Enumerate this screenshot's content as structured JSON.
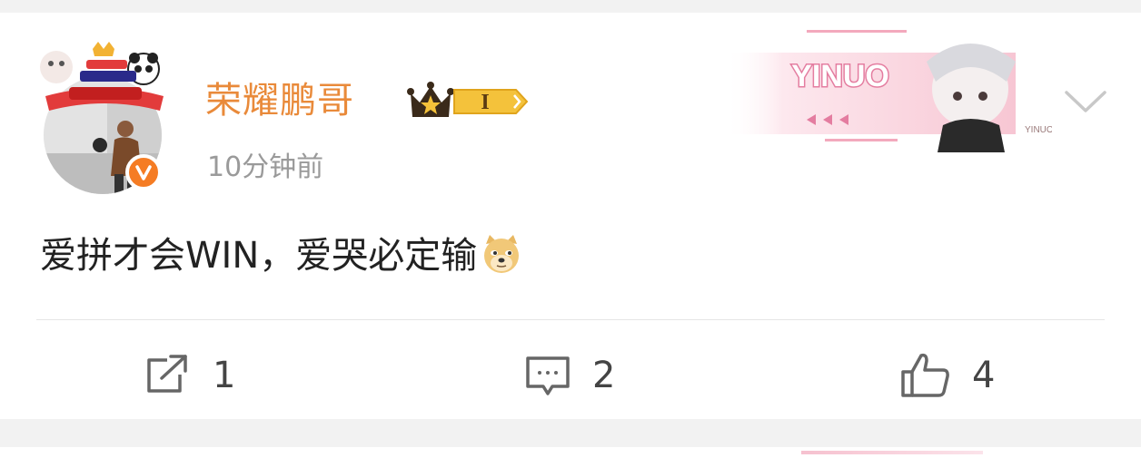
{
  "post": {
    "author": {
      "name": "荣耀鹏哥",
      "avatar_icon": "avatar-photo",
      "verified_icon": "verified-v-icon",
      "verified_color": "#f57c24",
      "badge": {
        "icon": "crown-icon",
        "level": "I"
      }
    },
    "time": "10分钟前",
    "decoration": {
      "text": "YINUO",
      "subtext": "YINUO",
      "accent": "#e47da0"
    },
    "more_icon": "chevron-down-icon",
    "content": {
      "text": "爱拼才会WIN，爱哭必定输",
      "emoji": "doge-emoji"
    },
    "actions": {
      "repost": {
        "icon": "repost-icon",
        "count": "1"
      },
      "comment": {
        "icon": "comment-icon",
        "count": "2"
      },
      "like": {
        "icon": "thumbs-up-icon",
        "count": "4"
      }
    }
  },
  "colors": {
    "username": "#e98a3a",
    "timestamp": "#9a9a9a",
    "background": "#f2f2f2",
    "card": "#ffffff"
  }
}
